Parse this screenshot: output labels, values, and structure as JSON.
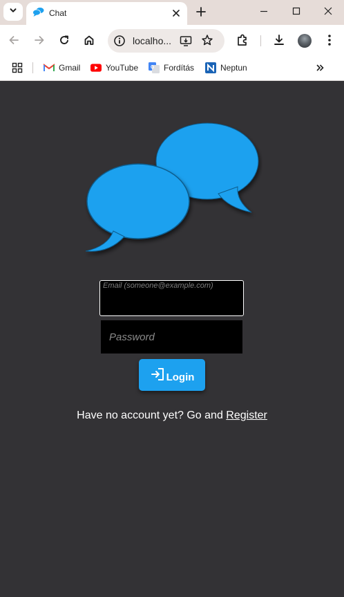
{
  "browser": {
    "tab_title": "Chat",
    "omnibox_url": "localho...",
    "bookmarks": [
      {
        "label": "Gmail"
      },
      {
        "label": "YouTube"
      },
      {
        "label": "Fordítás"
      },
      {
        "label": "Neptun"
      }
    ],
    "icons": [
      "tab-search-icon",
      "close-icon",
      "plus-icon",
      "minimize-icon",
      "maximize-icon",
      "window-close-icon",
      "back-arrow-icon",
      "forward-arrow-icon",
      "reload-icon",
      "home-icon",
      "info-icon",
      "install-app-icon",
      "star-icon",
      "extensions-icon",
      "download-icon",
      "more-vert-icon",
      "apps-grid-icon",
      "chevron-double-right-icon"
    ]
  },
  "login": {
    "email_label": "Email (someone@example.com)",
    "email_value": "",
    "password_placeholder": "Password",
    "login_button": "Login",
    "register_prompt": "Have no account yet? Go and ",
    "register_link": "Register"
  },
  "colors": {
    "page_background": "#333235",
    "accent": "#1da1ef",
    "input_background": "#000000",
    "text": "#ffffff"
  }
}
